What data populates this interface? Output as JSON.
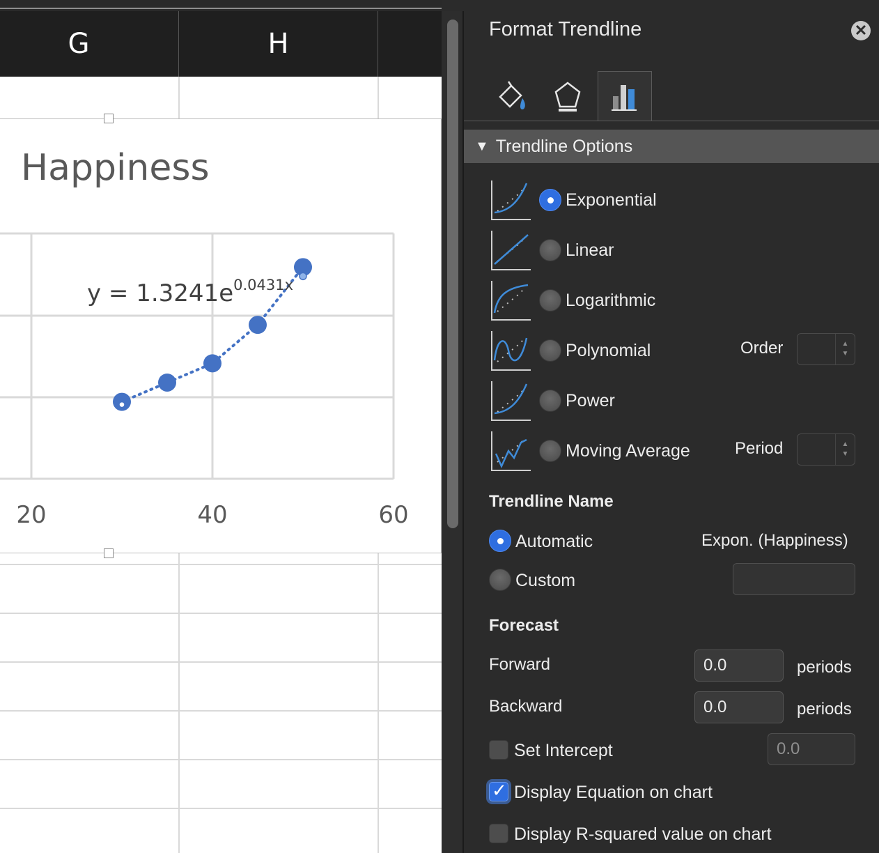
{
  "sheet": {
    "columns": [
      "G",
      "H"
    ]
  },
  "chart": {
    "equation_main": "y = 1.3241e",
    "equation_exp": "0.0431x"
  },
  "chart_data": {
    "type": "scatter",
    "title": "Happiness",
    "x_ticks": [
      "20",
      "40",
      "60"
    ],
    "xlim": [
      10,
      60
    ],
    "series": [
      {
        "values": [
          [
            30,
            6.1
          ],
          [
            35,
            6.5
          ],
          [
            40,
            6.9
          ],
          [
            45,
            7.7
          ],
          [
            50,
            8.9
          ]
        ]
      }
    ],
    "trendline": {
      "type": "exponential",
      "a": 1.3241,
      "b": 0.0431,
      "style": "dotted"
    },
    "colors": {
      "marker": "#4472c4",
      "trendline": "#4472c4"
    },
    "grid": true
  },
  "panel": {
    "title": "Format Trendline",
    "tabs": [
      {
        "name": "fill-line-tab",
        "icon": "paint-bucket-icon"
      },
      {
        "name": "effects-tab",
        "icon": "pentagon-icon"
      },
      {
        "name": "options-tab",
        "icon": "bar-chart-icon",
        "active": true
      }
    ],
    "section": "Trendline Options",
    "types": [
      {
        "label": "Exponential",
        "selected": true,
        "icon": "exponential-trend-icon"
      },
      {
        "label": "Linear",
        "selected": false,
        "icon": "linear-trend-icon"
      },
      {
        "label": "Logarithmic",
        "selected": false,
        "icon": "logarithmic-trend-icon"
      },
      {
        "label": "Polynomial",
        "selected": false,
        "icon": "polynomial-trend-icon"
      },
      {
        "label": "Power",
        "selected": false,
        "icon": "power-trend-icon"
      },
      {
        "label": "Moving Average",
        "selected": false,
        "icon": "moving-average-trend-icon"
      }
    ],
    "order_label": "Order",
    "period_label": "Period",
    "name_heading": "Trendline Name",
    "name_automatic": "Automatic",
    "name_automatic_value": "Expon. (Happiness)",
    "name_custom": "Custom",
    "forecast_heading": "Forecast",
    "forward_label": "Forward",
    "forward_value": "0.0",
    "backward_label": "Backward",
    "backward_value": "0.0",
    "periods_unit": "periods",
    "intercept_label": "Set Intercept",
    "intercept_value": "0.0",
    "display_equation_label": "Display Equation on chart",
    "display_equation_checked": true,
    "display_r2_label": "Display R-squared value on chart",
    "display_r2_checked": false
  }
}
